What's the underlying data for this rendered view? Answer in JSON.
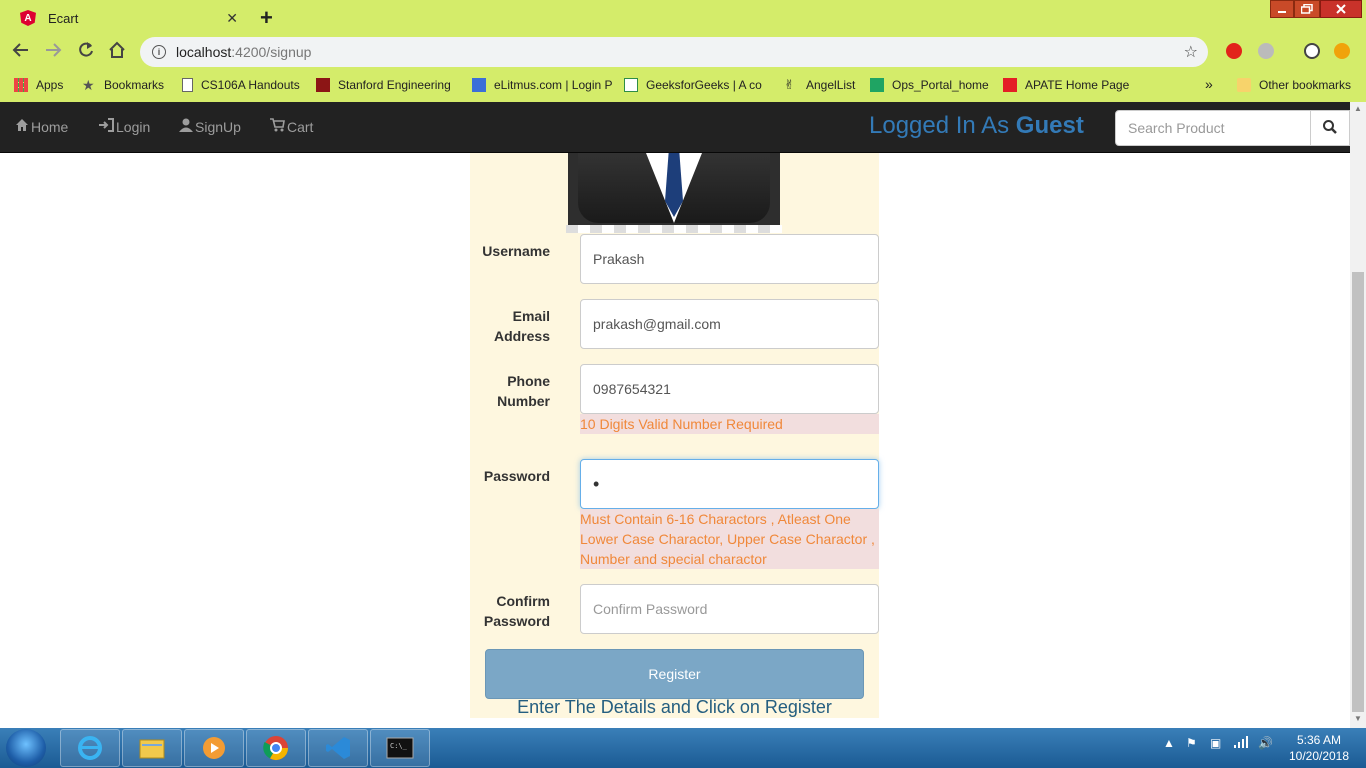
{
  "browser": {
    "tab_title": "Ecart",
    "tab_favicon": "A",
    "tab_close": "✕",
    "new_tab": "+",
    "url_host": "localhost",
    "url_path": ":4200/signup",
    "bookmarks": [
      {
        "label": "Apps"
      },
      {
        "label": "Bookmarks"
      },
      {
        "label": "CS106A Handouts"
      },
      {
        "label": "Stanford Engineering"
      },
      {
        "label": "eLitmus.com | Login P"
      },
      {
        "label": "GeeksforGeeks | A co"
      },
      {
        "label": "AngelList"
      },
      {
        "label": "Ops_Portal_home"
      },
      {
        "label": "APATE Home Page"
      }
    ],
    "bookmarks_more": "»",
    "other_bookmarks": "Other bookmarks"
  },
  "navbar": {
    "home": "Home",
    "login": "Login",
    "signup": "SignUp",
    "cart": "Cart",
    "logged_prefix": "Logged In As ",
    "logged_user": "Guest",
    "search_placeholder": "Search Product"
  },
  "form": {
    "username_label": "Username",
    "username_value": "Prakash",
    "email_label_1": "Email",
    "email_label_2": "Address",
    "email_value": "prakash@gmail.com",
    "phone_label_1": "Phone",
    "phone_label_2": "Number",
    "phone_value": "0987654321",
    "phone_error": "10 Digits Valid Number Required",
    "password_label": "Password",
    "password_value": "•",
    "password_error_1": "Must Contain 6-16 Charactors , Atleast One",
    "password_error_2": "Lower Case Charactor, Upper Case Charactor ,",
    "password_error_3": "Number and special charactor",
    "confirm_label_1": "Confirm",
    "confirm_label_2": "Password",
    "confirm_placeholder": "Confirm Password",
    "register_label": "Register",
    "hint": "Enter The Details and Click on Register"
  },
  "taskbar": {
    "time": "5:36 AM",
    "date": "10/20/2018"
  },
  "colors": {
    "browser_theme": "#d4ec6a",
    "navbar_bg": "#222222",
    "accent": "#337ab7",
    "panel_bg": "#fef7df",
    "error_text": "#f0883a",
    "error_bg": "#f2dede"
  }
}
